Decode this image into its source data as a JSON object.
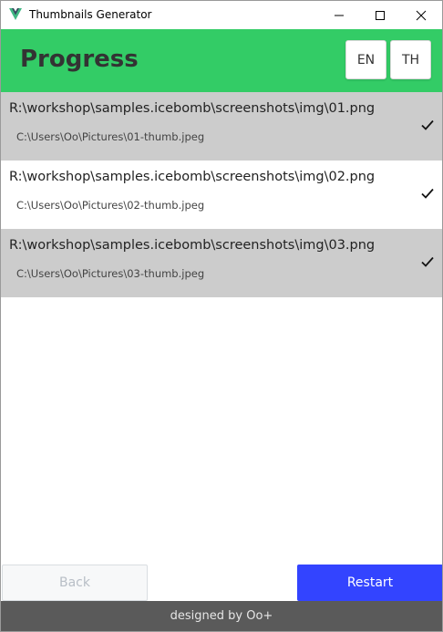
{
  "window": {
    "title": "Thumbnails Generator",
    "icon": "vue-logo-icon"
  },
  "header": {
    "title": "Progress",
    "languages": [
      "EN",
      "TH"
    ]
  },
  "items": [
    {
      "source": "R:\\workshop\\samples.icebomb\\screenshots\\img\\01.png",
      "output": "C:\\Users\\Oo\\Pictures\\01-thumb.jpeg",
      "status": "done"
    },
    {
      "source": "R:\\workshop\\samples.icebomb\\screenshots\\img\\02.png",
      "output": "C:\\Users\\Oo\\Pictures\\02-thumb.jpeg",
      "status": "done"
    },
    {
      "source": "R:\\workshop\\samples.icebomb\\screenshots\\img\\03.png",
      "output": "C:\\Users\\Oo\\Pictures\\03-thumb.jpeg",
      "status": "done"
    }
  ],
  "actions": {
    "back_label": "Back",
    "restart_label": "Restart"
  },
  "footer": {
    "credit": "designed by Oo+"
  },
  "colors": {
    "header_bg": "#33cc66",
    "primary": "#3344ff",
    "row_shaded": "#cccccc",
    "footer_bg": "#5a5a5a"
  }
}
